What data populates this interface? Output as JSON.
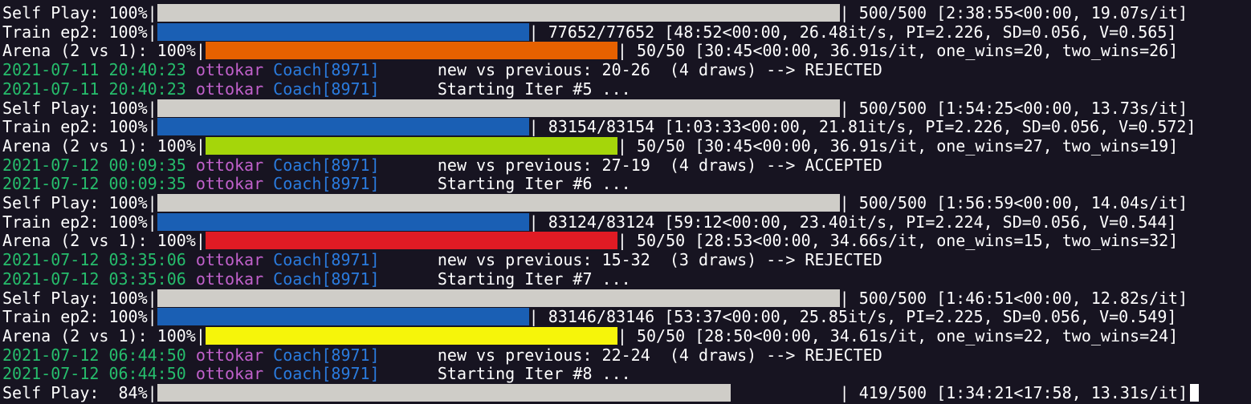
{
  "colors": {
    "background": "#171421",
    "text": "#ffffff",
    "timestamp": "#26bd6c",
    "user": "#c061cb",
    "module": "#2a7bde",
    "track_gray": "#cfcdc8",
    "train_blue": "#1a5fb4",
    "arena_orange": "#e66100",
    "arena_green": "#a5d60a",
    "arena_red": "#e01b24",
    "arena_yellow": "#f6f50a"
  },
  "lines": [
    {
      "kind": "bar",
      "label": "Self Play: 100%|",
      "progress": 1.0,
      "color": "#cfcdc8",
      "stats": "| 500/500 [2:38:55<00:00, 19.07s/it]"
    },
    {
      "kind": "bar",
      "label": "Train ep2: 100%|",
      "progress": 1.0,
      "color": "#1a5fb4",
      "stats": "| 77652/77652 [48:52<00:00, 26.48it/s, PI=2.226, SD=0.056, V=0.565]"
    },
    {
      "kind": "bar",
      "label": "Arena (2 vs 1): 100%|",
      "progress": 1.0,
      "color": "#e66100",
      "stats": "| 50/50 [30:45<00:00, 36.91s/it, one_wins=20, two_wins=26]"
    },
    {
      "kind": "log",
      "ts": "2021-07-11 20:40:23",
      "user": "ottokar",
      "module": "Coach[8971]",
      "msg": "new vs previous: 20-26  (4 draws) --> REJECTED"
    },
    {
      "kind": "log",
      "ts": "2021-07-11 20:40:23",
      "user": "ottokar",
      "module": "Coach[8971]",
      "msg": "Starting Iter #5 ..."
    },
    {
      "kind": "bar",
      "label": "Self Play: 100%|",
      "progress": 1.0,
      "color": "#cfcdc8",
      "stats": "| 500/500 [1:54:25<00:00, 13.73s/it]"
    },
    {
      "kind": "bar",
      "label": "Train ep2: 100%|",
      "progress": 1.0,
      "color": "#1a5fb4",
      "stats": "| 83154/83154 [1:03:33<00:00, 21.81it/s, PI=2.226, SD=0.056, V=0.572]"
    },
    {
      "kind": "bar",
      "label": "Arena (2 vs 1): 100%|",
      "progress": 1.0,
      "color": "#a5d60a",
      "stats": "| 50/50 [30:45<00:00, 36.91s/it, one_wins=27, two_wins=19]"
    },
    {
      "kind": "log",
      "ts": "2021-07-12 00:09:35",
      "user": "ottokar",
      "module": "Coach[8971]",
      "msg": "new vs previous: 27-19  (4 draws) --> ACCEPTED"
    },
    {
      "kind": "log",
      "ts": "2021-07-12 00:09:35",
      "user": "ottokar",
      "module": "Coach[8971]",
      "msg": "Starting Iter #6 ..."
    },
    {
      "kind": "bar",
      "label": "Self Play: 100%|",
      "progress": 1.0,
      "color": "#cfcdc8",
      "stats": "| 500/500 [1:56:59<00:00, 14.04s/it]"
    },
    {
      "kind": "bar",
      "label": "Train ep2: 100%|",
      "progress": 1.0,
      "color": "#1a5fb4",
      "stats": "| 83124/83124 [59:12<00:00, 23.40it/s, PI=2.224, SD=0.056, V=0.544]"
    },
    {
      "kind": "bar",
      "label": "Arena (2 vs 1): 100%|",
      "progress": 1.0,
      "color": "#e01b24",
      "stats": "| 50/50 [28:53<00:00, 34.66s/it, one_wins=15, two_wins=32]"
    },
    {
      "kind": "log",
      "ts": "2021-07-12 03:35:06",
      "user": "ottokar",
      "module": "Coach[8971]",
      "msg": "new vs previous: 15-32  (3 draws) --> REJECTED"
    },
    {
      "kind": "log",
      "ts": "2021-07-12 03:35:06",
      "user": "ottokar",
      "module": "Coach[8971]",
      "msg": "Starting Iter #7 ..."
    },
    {
      "kind": "bar",
      "label": "Self Play: 100%|",
      "progress": 1.0,
      "color": "#cfcdc8",
      "stats": "| 500/500 [1:46:51<00:00, 12.82s/it]"
    },
    {
      "kind": "bar",
      "label": "Train ep2: 100%|",
      "progress": 1.0,
      "color": "#1a5fb4",
      "stats": "| 83146/83146 [53:37<00:00, 25.85it/s, PI=2.225, SD=0.056, V=0.549]"
    },
    {
      "kind": "bar",
      "label": "Arena (2 vs 1): 100%|",
      "progress": 1.0,
      "color": "#f6f50a",
      "stats": "| 50/50 [28:50<00:00, 34.61s/it, one_wins=22, two_wins=24]"
    },
    {
      "kind": "log",
      "ts": "2021-07-12 06:44:50",
      "user": "ottokar",
      "module": "Coach[8971]",
      "msg": "new vs previous: 22-24  (4 draws) --> REJECTED"
    },
    {
      "kind": "log",
      "ts": "2021-07-12 06:44:50",
      "user": "ottokar",
      "module": "Coach[8971]",
      "msg": "Starting Iter #8 ..."
    },
    {
      "kind": "bar",
      "label": "Self Play:  84%|",
      "progress": 0.84,
      "color": "#cfcdc8",
      "stats": "| 419/500 [1:34:21<17:58, 13.31s/it]",
      "cursor": true
    }
  ]
}
